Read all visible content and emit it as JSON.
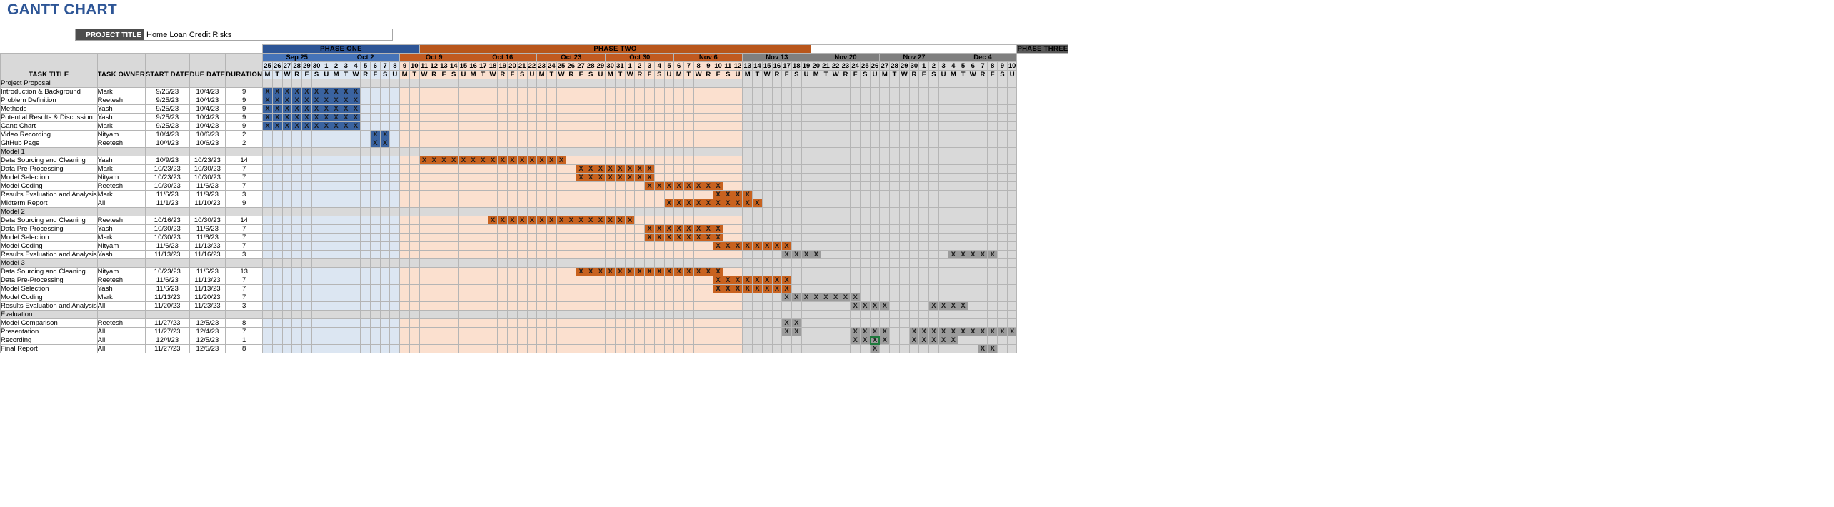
{
  "header": {
    "chart_title": "GANTT CHART",
    "project_title_label": "PROJECT TITLE",
    "project_title_value": "Home Loan Credit Risks"
  },
  "colors": {
    "title_blue": "#2d5596",
    "phase_one": "#2d5596",
    "phase_two": "#b8561b",
    "phase_three": "#595959",
    "week_blue": "#4573b8",
    "week_orange": "#c15a20",
    "week_gray": "#7f7f7f",
    "fill_blue": "#3a63a0",
    "fill_orange": "#c8621f",
    "fill_gray": "#9c9c9c",
    "tint_blue": "#dce6f2",
    "tint_orange": "#fbe0cf",
    "tint_gray": "#d9d9d9",
    "blackout": "#000000",
    "selection_green": "#1f7a3d"
  },
  "columns": {
    "task_title": "TASK TITLE",
    "task_owner": "TASK OWNER",
    "start_date": "START DATE",
    "due_date": "DUE DATE",
    "duration": "DURATION"
  },
  "phases": [
    {
      "label": "PHASE ONE",
      "style": "phase1",
      "span": 16
    },
    {
      "label": "PHASE TWO",
      "style": "phase2",
      "span": 40
    },
    {
      "label": "",
      "style": "phase-blank",
      "span": 21
    },
    {
      "label": "PHASE THREE",
      "style": "phase3",
      "span": 61
    }
  ],
  "weeks": [
    {
      "label": "Sep 25",
      "style": "w-blue",
      "tint": "t-blue",
      "days": [
        25,
        26,
        27,
        28,
        29,
        30,
        1
      ]
    },
    {
      "label": "Oct 2",
      "style": "w-blue",
      "tint": "t-blue",
      "days": [
        2,
        3,
        4,
        5,
        6,
        7,
        8
      ]
    },
    {
      "label": "Oct 9",
      "style": "w-orange",
      "tint": "t-orange",
      "days": [
        9,
        10,
        11,
        12,
        13,
        14,
        15
      ]
    },
    {
      "label": "Oct 16",
      "style": "w-orange",
      "tint": "t-orange",
      "days": [
        16,
        17,
        18,
        19,
        20,
        21,
        22
      ]
    },
    {
      "label": "Oct 23",
      "style": "w-orange",
      "tint": "t-orange",
      "days": [
        23,
        24,
        25,
        26,
        27,
        28,
        29
      ]
    },
    {
      "label": "Oct 30",
      "style": "w-orange",
      "tint": "t-orange",
      "days": [
        30,
        31,
        1,
        2,
        3,
        4,
        5
      ]
    },
    {
      "label": "Nov 6",
      "style": "w-orange",
      "tint": "t-orange",
      "days": [
        6,
        7,
        8,
        9,
        10,
        11,
        12
      ]
    },
    {
      "label": "Nov 13",
      "style": "w-gray",
      "tint": "t-gray",
      "days": [
        13,
        14,
        15,
        16,
        17,
        18,
        19
      ]
    },
    {
      "label": "Nov 20",
      "style": "w-gray",
      "tint": "t-gray",
      "days": [
        20,
        21,
        22,
        23,
        24,
        25,
        26
      ]
    },
    {
      "label": "Nov 27",
      "style": "w-gray",
      "tint": "t-gray",
      "days": [
        27,
        28,
        29,
        30,
        1,
        2,
        3
      ]
    },
    {
      "label": "Dec 4",
      "style": "w-gray",
      "tint": "t-gray",
      "days": [
        4,
        5,
        6,
        7,
        8,
        9,
        10
      ]
    }
  ],
  "day_letters": [
    "M",
    "T",
    "W",
    "R",
    "F",
    "S",
    "U"
  ],
  "mark": "X",
  "rows": [
    {
      "type": "group",
      "title": "Project Proposal",
      "owner": "",
      "start": "",
      "due": "",
      "duration": ""
    },
    {
      "type": "task",
      "title": "Introduction & Background",
      "owner": "Mark",
      "start": "9/25/23",
      "due": "10/4/23",
      "duration": "9",
      "bar_start": 0,
      "bar_len": 10,
      "bar_style": "f-blue"
    },
    {
      "type": "task",
      "title": "Problem Definition",
      "owner": "Reetesh",
      "start": "9/25/23",
      "due": "10/4/23",
      "duration": "9",
      "bar_start": 0,
      "bar_len": 10,
      "bar_style": "f-blue"
    },
    {
      "type": "task",
      "title": "Methods",
      "owner": "Yash",
      "start": "9/25/23",
      "due": "10/4/23",
      "duration": "9",
      "bar_start": 0,
      "bar_len": 10,
      "bar_style": "f-blue"
    },
    {
      "type": "task",
      "title": "Potential Results & Discussion",
      "owner": "Yash",
      "start": "9/25/23",
      "due": "10/4/23",
      "duration": "9",
      "bar_start": 0,
      "bar_len": 10,
      "bar_style": "f-blue"
    },
    {
      "type": "task",
      "title": "Gantt Chart",
      "owner": "Mark",
      "start": "9/25/23",
      "due": "10/4/23",
      "duration": "9",
      "bar_start": 0,
      "bar_len": 10,
      "bar_style": "f-blue"
    },
    {
      "type": "task",
      "title": "Video Recording",
      "owner": "Nityam",
      "start": "10/4/23",
      "due": "10/6/23",
      "duration": "2",
      "bar_start": 11,
      "bar_len": 2,
      "bar_style": "f-blue"
    },
    {
      "type": "task",
      "title": "GitHub Page",
      "owner": "Reetesh",
      "start": "10/4/23",
      "due": "10/6/23",
      "duration": "2",
      "bar_start": 11,
      "bar_len": 2,
      "bar_style": "f-blue"
    },
    {
      "type": "group",
      "title": "Model 1",
      "owner": "",
      "start": "",
      "due": "",
      "duration": ""
    },
    {
      "type": "task",
      "title": "Data Sourcing and Cleaning",
      "owner": "Yash",
      "start": "10/9/23",
      "due": "10/23/23",
      "duration": "14",
      "bar_start": 16,
      "bar_len": 15,
      "bar_style": "f-orange"
    },
    {
      "type": "task",
      "title": "Data Pre-Processing",
      "owner": "Mark",
      "start": "10/23/23",
      "due": "10/30/23",
      "duration": "7",
      "bar_start": 32,
      "bar_len": 8,
      "bar_style": "f-orange"
    },
    {
      "type": "task",
      "title": "Model Selection",
      "owner": "Nityam",
      "start": "10/23/23",
      "due": "10/30/23",
      "duration": "7",
      "bar_start": 32,
      "bar_len": 8,
      "bar_style": "f-orange"
    },
    {
      "type": "task",
      "title": "Model Coding",
      "owner": "Reetesh",
      "start": "10/30/23",
      "due": "11/6/23",
      "duration": "7",
      "bar_start": 39,
      "bar_len": 8,
      "bar_style": "f-orange"
    },
    {
      "type": "task",
      "title": "Results Evaluation and Analysis",
      "owner": "Mark",
      "start": "11/6/23",
      "due": "11/9/23",
      "duration": "3",
      "bar_start": 46,
      "bar_len": 4,
      "bar_style": "f-orange"
    },
    {
      "type": "task",
      "title": "Midterm Report",
      "owner": "All",
      "start": "11/1/23",
      "due": "11/10/23",
      "duration": "9",
      "bar_start": 41,
      "bar_len": 10,
      "bar_style": "f-orange"
    },
    {
      "type": "group",
      "title": "Model 2",
      "owner": "",
      "start": "",
      "due": "",
      "duration": ""
    },
    {
      "type": "task",
      "title": "Data Sourcing and Cleaning",
      "owner": "Reetesh",
      "start": "10/16/23",
      "due": "10/30/23",
      "duration": "14",
      "bar_start": 23,
      "bar_len": 15,
      "bar_style": "f-orange"
    },
    {
      "type": "task",
      "title": "Data Pre-Processing",
      "owner": "Yash",
      "start": "10/30/23",
      "due": "11/6/23",
      "duration": "7",
      "bar_start": 39,
      "bar_len": 8,
      "bar_style": "f-orange"
    },
    {
      "type": "task",
      "title": "Model Selection",
      "owner": "Mark",
      "start": "10/30/23",
      "due": "11/6/23",
      "duration": "7",
      "bar_start": 39,
      "bar_len": 8,
      "bar_style": "f-orange"
    },
    {
      "type": "task",
      "title": "Model Coding",
      "owner": "Nityam",
      "start": "11/6/23",
      "due": "11/13/23",
      "duration": "7",
      "bar_start": 46,
      "bar_len": 8,
      "bar_style": "f-orange"
    },
    {
      "type": "task",
      "title": "Results Evaluation and Analysis",
      "owner": "Yash",
      "start": "11/13/23",
      "due": "11/16/23",
      "duration": "3",
      "bar_start": 53,
      "bar_len": 4,
      "bar_style": "f-gray"
    },
    {
      "type": "group",
      "title": "Model 3",
      "owner": "",
      "start": "",
      "due": "",
      "duration": ""
    },
    {
      "type": "task",
      "title": "Data Sourcing and Cleaning",
      "owner": "Nityam",
      "start": "10/23/23",
      "due": "11/6/23",
      "duration": "13",
      "bar_start": 32,
      "bar_len": 15,
      "bar_style": "f-orange"
    },
    {
      "type": "task",
      "title": "Data Pre-Processing",
      "owner": "Reetesh",
      "start": "11/6/23",
      "due": "11/13/23",
      "duration": "7",
      "bar_start": 46,
      "bar_len": 8,
      "bar_style": "f-orange"
    },
    {
      "type": "task",
      "title": "Model Selection",
      "owner": "Yash",
      "start": "11/6/23",
      "due": "11/13/23",
      "duration": "7",
      "bar_start": 46,
      "bar_len": 8,
      "bar_style": "f-orange"
    },
    {
      "type": "task",
      "title": "Model Coding",
      "owner": "Mark",
      "start": "11/13/23",
      "due": "11/20/23",
      "duration": "7",
      "bar_start": 53,
      "bar_len": 8,
      "bar_style": "f-gray"
    },
    {
      "type": "task",
      "title": "Results Evaluation and Analysis",
      "owner": "All",
      "start": "11/20/23",
      "due": "11/23/23",
      "duration": "3",
      "bar_start": 60,
      "bar_len": 4,
      "bar_style": "f-gray"
    },
    {
      "type": "group",
      "title": "Evaluation",
      "owner": "",
      "start": "",
      "due": "",
      "duration": ""
    },
    {
      "type": "task",
      "title": "Model Comparison",
      "owner": "Reetesh",
      "start": "11/27/23",
      "due": "12/5/23",
      "duration": "8",
      "bar_start": 53,
      "bar_len": 2,
      "bar_style": "f-gray"
    },
    {
      "type": "task",
      "title": "Presentation",
      "owner": "All",
      "start": "11/27/23",
      "due": "12/4/23",
      "duration": "7",
      "bar_start": 53,
      "bar_len": 2,
      "bar_style": "f-gray"
    },
    {
      "type": "task",
      "title": "Recording",
      "owner": "All",
      "start": "12/4/23",
      "due": "12/5/23",
      "duration": "1",
      "bar_start": 62,
      "bar_len": 1,
      "bar_style": "f-gray",
      "selected": true
    },
    {
      "type": "task",
      "title": "Final Report",
      "owner": "All",
      "start": "11/27/23",
      "due": "12/5/23",
      "duration": "8",
      "bar_start": 62,
      "bar_len": 1,
      "bar_style": "f-gray"
    }
  ],
  "extra_marks": [
    {
      "row": 20,
      "cells": [
        [
          70,
          74
        ]
      ]
    },
    {
      "row": 26,
      "cells": [
        [
          68,
          71
        ]
      ]
    },
    {
      "row": 29,
      "cells": [
        [
          60,
          63
        ],
        [
          66,
          76
        ]
      ]
    },
    {
      "row": 30,
      "cells": [
        [
          60,
          63
        ],
        [
          66,
          70
        ]
      ]
    },
    {
      "row": 31,
      "cells": [
        [
          73,
          74
        ]
      ]
    },
    {
      "row": 32,
      "cells": [
        [
          60,
          61
        ],
        [
          66,
          76
        ]
      ]
    }
  ],
  "blackout_start": 56,
  "blackout_end": 62
}
